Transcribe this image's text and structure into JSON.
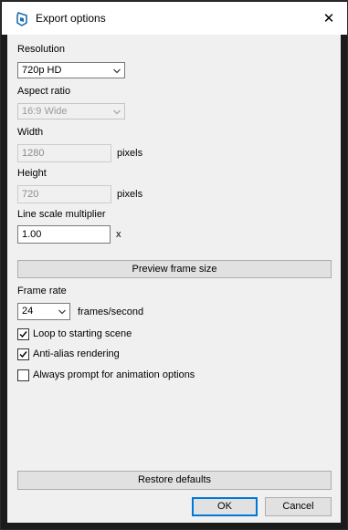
{
  "window": {
    "title": "Export options",
    "close_glyph": "✕",
    "icon": "sketchup-icon"
  },
  "resolution": {
    "label": "Resolution",
    "selected": "720p HD"
  },
  "aspect_ratio": {
    "label": "Aspect ratio",
    "selected": "16:9 Wide"
  },
  "width": {
    "label": "Width",
    "value": "1280",
    "unit": "pixels"
  },
  "height": {
    "label": "Height",
    "value": "720",
    "unit": "pixels"
  },
  "line_scale": {
    "label": "Line scale multiplier",
    "value": "1.00",
    "unit": "x"
  },
  "preview_button": "Preview frame size",
  "frame_rate": {
    "label": "Frame rate",
    "selected": "24",
    "unit": "frames/second"
  },
  "options": [
    {
      "label": "Loop to starting scene",
      "checked": true
    },
    {
      "label": "Anti-alias rendering",
      "checked": true
    },
    {
      "label": "Always prompt for animation options",
      "checked": false
    }
  ],
  "restore_button": "Restore defaults",
  "ok_button": "OK",
  "cancel_button": "Cancel",
  "colors": {
    "accent": "#0078d7",
    "dialog_bg": "#f0f0f0",
    "sketchup_blue": "#1a6fb0"
  }
}
